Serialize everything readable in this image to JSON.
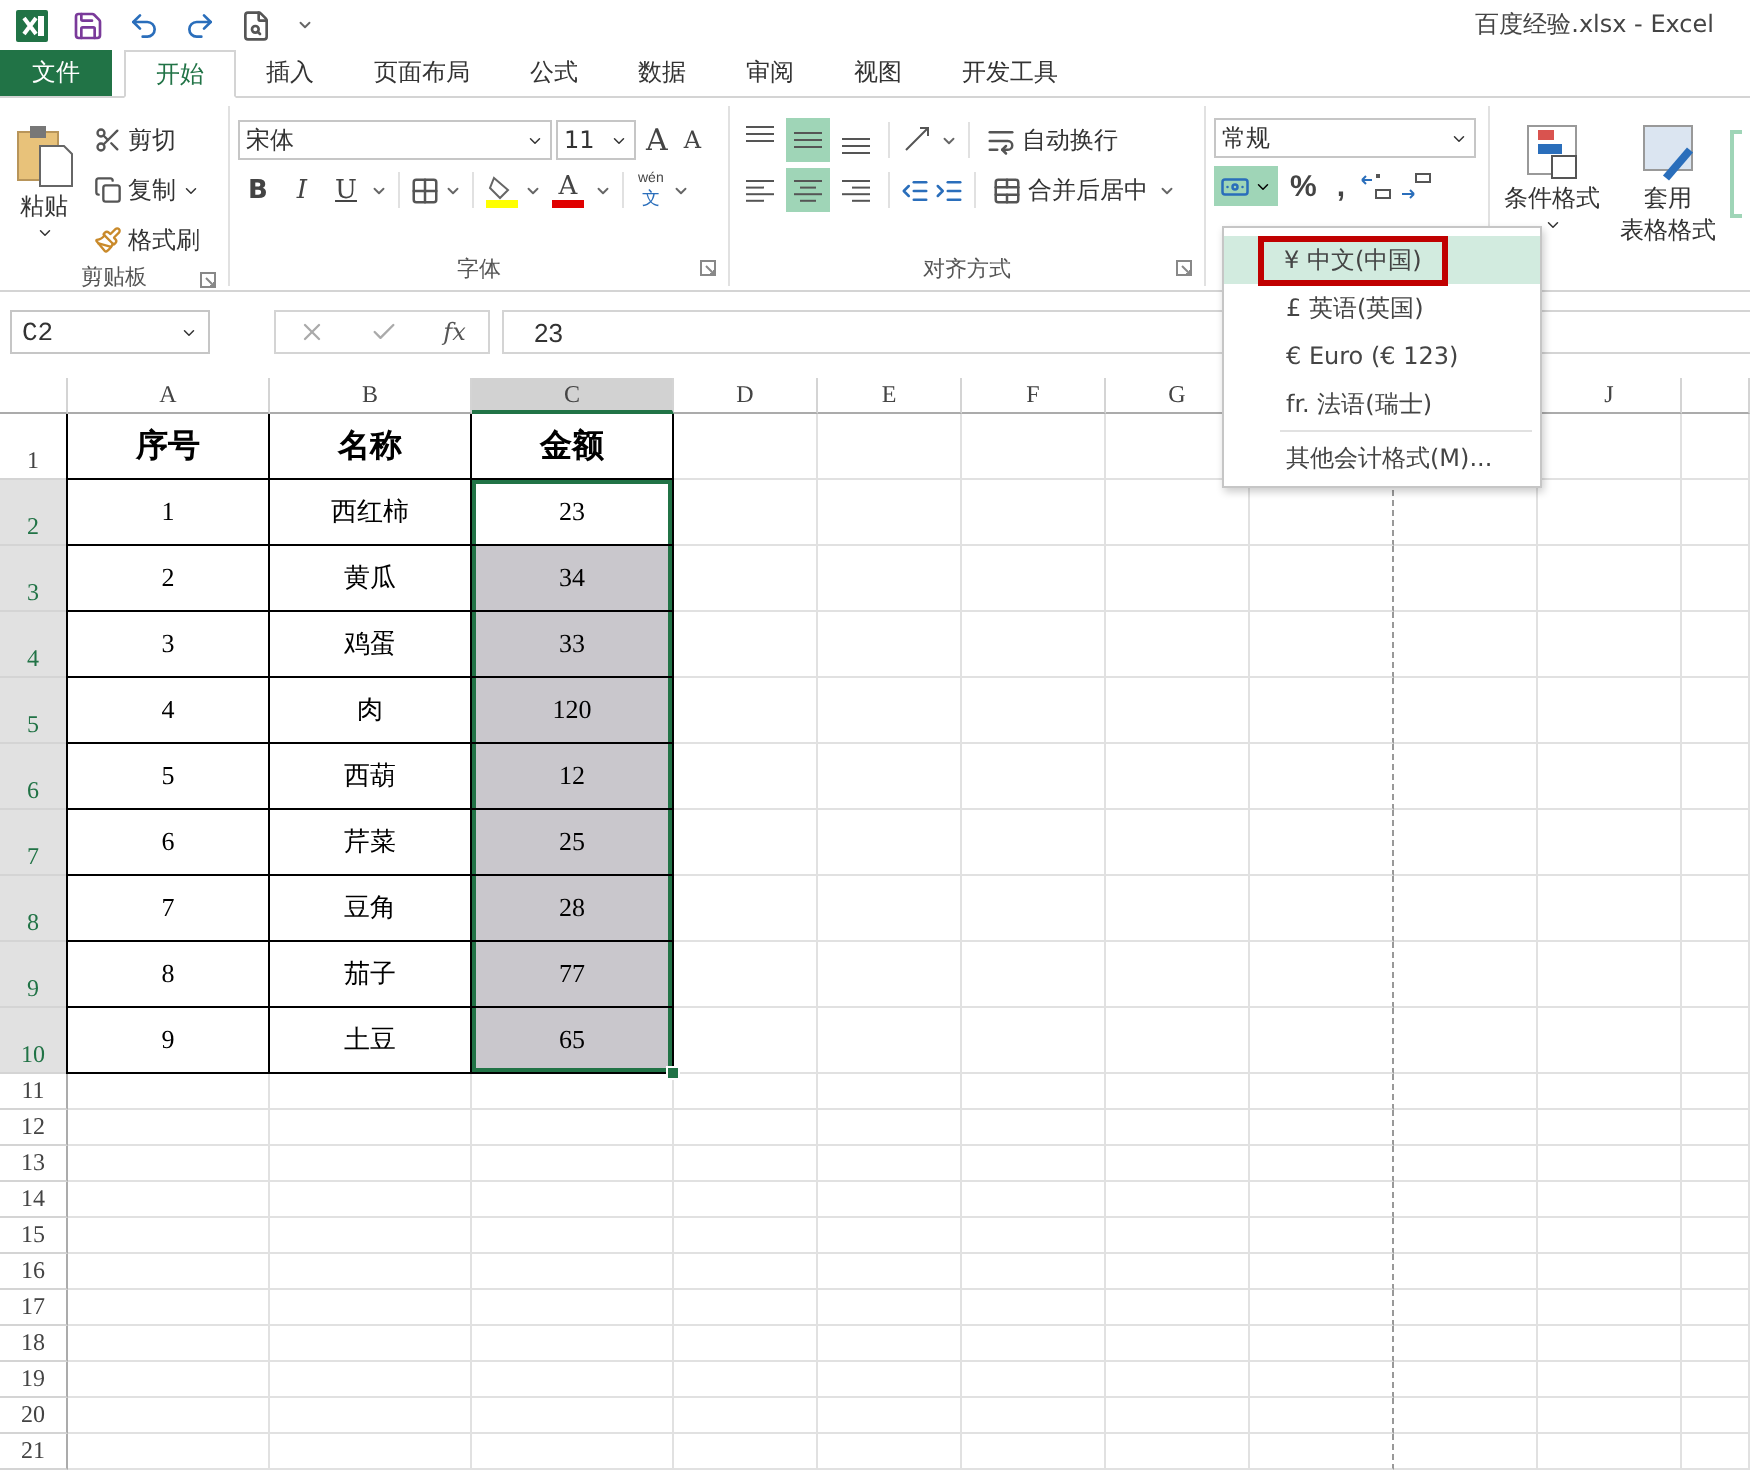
{
  "window": {
    "title": "百度经验.xlsx - Excel"
  },
  "tabs": [
    {
      "label": "文件",
      "kind": "file",
      "selected": false
    },
    {
      "label": "开始",
      "kind": "tab",
      "selected": true
    },
    {
      "label": "插入",
      "kind": "tab",
      "selected": false
    },
    {
      "label": "页面布局",
      "kind": "tab",
      "selected": false
    },
    {
      "label": "公式",
      "kind": "tab",
      "selected": false
    },
    {
      "label": "数据",
      "kind": "tab",
      "selected": false
    },
    {
      "label": "审阅",
      "kind": "tab",
      "selected": false
    },
    {
      "label": "视图",
      "kind": "tab",
      "selected": false
    },
    {
      "label": "开发工具",
      "kind": "tab",
      "selected": false
    }
  ],
  "ribbon": {
    "clipboard": {
      "paste": "粘贴",
      "cut": "剪切",
      "copy": "复制",
      "painter": "格式刷",
      "label": "剪贴板"
    },
    "font": {
      "name": "宋体",
      "size": "11",
      "grow": "A",
      "shrink": "A",
      "bold": "B",
      "italic": "I",
      "underline": "U",
      "font_color": "A",
      "phonetic_top": "wén",
      "phonetic_bottom": "文",
      "label": "字体"
    },
    "alignment": {
      "vertical": [
        {
          "kind": "top",
          "selected": false
        },
        {
          "kind": "middle",
          "selected": true
        },
        {
          "kind": "bottom",
          "selected": false
        }
      ],
      "horizontal": [
        {
          "kind": "left",
          "selected": false
        },
        {
          "kind": "center",
          "selected": true
        },
        {
          "kind": "right",
          "selected": false
        }
      ],
      "wrap": "自动换行",
      "merge": "合并后居中",
      "label": "对齐方式"
    },
    "number": {
      "format": "常规",
      "currency_expanded": true,
      "percent": "%",
      "comma": ","
    },
    "styles": {
      "conditional": "条件格式",
      "table_top": "套用",
      "table_bottom": "表格格式"
    }
  },
  "formula_bar": {
    "name_box": "C2",
    "fx": "fx",
    "value": "23"
  },
  "sheet": {
    "columns": [
      {
        "label": "A",
        "kind": "plain",
        "selected": false
      },
      {
        "label": "B",
        "kind": "plain",
        "selected": false
      },
      {
        "label": "C",
        "kind": "plain",
        "selected": true
      },
      {
        "label": "D",
        "kind": "plain",
        "selected": false
      },
      {
        "label": "E",
        "kind": "plain",
        "selected": false
      },
      {
        "label": "F",
        "kind": "plain",
        "selected": false
      },
      {
        "label": "G",
        "kind": "plain",
        "selected": false
      },
      {
        "label": "J",
        "kind": "after_menu",
        "selected": false
      }
    ],
    "rows": [
      {
        "number": "1",
        "selected": false,
        "cells": [
          {
            "text": "序号",
            "selected": false
          },
          {
            "text": "名称",
            "selected": false
          },
          {
            "text": "金额",
            "selected": false
          }
        ]
      },
      {
        "number": "2",
        "selected": true,
        "cells": [
          {
            "text": "1",
            "selected": false
          },
          {
            "text": "西红柿",
            "selected": false
          },
          {
            "text": "23",
            "selected": true
          }
        ]
      },
      {
        "number": "3",
        "selected": true,
        "cells": [
          {
            "text": "2",
            "selected": false
          },
          {
            "text": "黄瓜",
            "selected": false
          },
          {
            "text": "34",
            "selected": true
          }
        ]
      },
      {
        "number": "4",
        "selected": true,
        "cells": [
          {
            "text": "3",
            "selected": false
          },
          {
            "text": "鸡蛋",
            "selected": false
          },
          {
            "text": "33",
            "selected": true
          }
        ]
      },
      {
        "number": "5",
        "selected": true,
        "cells": [
          {
            "text": "4",
            "selected": false
          },
          {
            "text": "肉",
            "selected": false
          },
          {
            "text": "120",
            "selected": true
          }
        ]
      },
      {
        "number": "6",
        "selected": true,
        "cells": [
          {
            "text": "5",
            "selected": false
          },
          {
            "text": "西葫",
            "selected": false
          },
          {
            "text": "12",
            "selected": true
          }
        ]
      },
      {
        "number": "7",
        "selected": true,
        "cells": [
          {
            "text": "6",
            "selected": false
          },
          {
            "text": "芹菜",
            "selected": false
          },
          {
            "text": "25",
            "selected": true
          }
        ]
      },
      {
        "number": "8",
        "selected": true,
        "cells": [
          {
            "text": "7",
            "selected": false
          },
          {
            "text": "豆角",
            "selected": false
          },
          {
            "text": "28",
            "selected": true
          }
        ]
      },
      {
        "number": "9",
        "selected": true,
        "cells": [
          {
            "text": "8",
            "selected": false
          },
          {
            "text": "茄子",
            "selected": false
          },
          {
            "text": "77",
            "selected": true
          }
        ]
      },
      {
        "number": "10",
        "selected": true,
        "cells": [
          {
            "text": "9",
            "selected": false
          },
          {
            "text": "土豆",
            "selected": false
          },
          {
            "text": "65",
            "selected": true
          }
        ]
      },
      {
        "number": "11",
        "selected": false
      },
      {
        "number": "12",
        "selected": false
      },
      {
        "number": "13",
        "selected": false
      },
      {
        "number": "14",
        "selected": false
      },
      {
        "number": "15",
        "selected": false
      },
      {
        "number": "16",
        "selected": false
      },
      {
        "number": "17",
        "selected": false
      },
      {
        "number": "18",
        "selected": false
      },
      {
        "number": "19",
        "selected": false
      },
      {
        "number": "20",
        "selected": false
      },
      {
        "number": "21",
        "selected": false
      }
    ]
  },
  "dropdown": {
    "items": [
      {
        "label": "¥ 中文(中国)",
        "kind": "option",
        "selected": true
      },
      {
        "label": "£ 英语(英国)",
        "kind": "option",
        "selected": false
      },
      {
        "label": "€ Euro (€ 123)",
        "kind": "option",
        "selected": false
      },
      {
        "label": "fr. 法语(瑞士)",
        "kind": "option",
        "selected": false
      },
      {
        "label": "其他会计格式(M)...",
        "kind": "more",
        "selected": false
      }
    ]
  }
}
